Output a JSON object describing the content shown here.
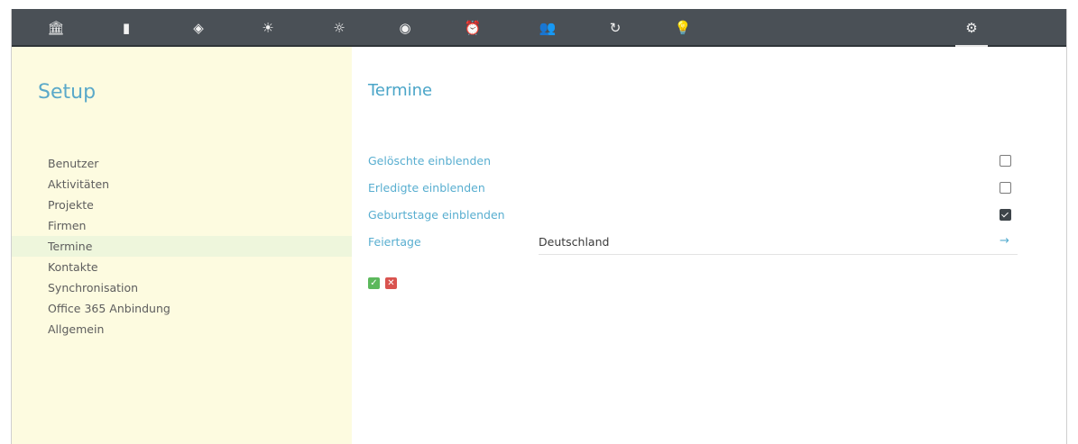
{
  "nav": {
    "icons": [
      {
        "name": "bank-icon",
        "glyph": "🏛"
      },
      {
        "name": "document-icon",
        "glyph": "▮"
      },
      {
        "name": "target-icon",
        "glyph": "◈"
      },
      {
        "name": "sun-icon",
        "glyph": "☀"
      },
      {
        "name": "sun-outline-icon",
        "glyph": "☼"
      },
      {
        "name": "record-icon",
        "glyph": "◉"
      },
      {
        "name": "alarm-clock-icon",
        "glyph": "⏰"
      },
      {
        "name": "users-icon",
        "glyph": "👥"
      },
      {
        "name": "refresh-icon",
        "glyph": "↻"
      },
      {
        "name": "lightbulb-icon",
        "glyph": "💡"
      },
      {
        "name": "gear-icon",
        "glyph": "⚙",
        "active": true
      }
    ]
  },
  "sidebar": {
    "title": "Setup",
    "items": [
      "Benutzer",
      "Aktivitäten",
      "Projekte",
      "Firmen",
      "Termine",
      "Kontakte",
      "Synchronisation",
      "Office 365 Anbindung",
      "Allgemein"
    ],
    "selected": "Termine"
  },
  "main": {
    "title": "Termine",
    "options": [
      {
        "label": "Gelöschte einblenden",
        "checked": false
      },
      {
        "label": "Erledigte einblenden",
        "checked": false
      },
      {
        "label": "Geburtstage einblenden",
        "checked": true
      }
    ],
    "holidays": {
      "label": "Feiertage",
      "value": "Deutschland",
      "arrow": "→"
    },
    "buttons": {
      "ok": "✓",
      "cancel": "✕"
    }
  },
  "colors": {
    "topbar": "#4a5056",
    "sidebar": "#fdfbe0",
    "accent": "#5aa9c9",
    "selected": "#eef6dc"
  }
}
